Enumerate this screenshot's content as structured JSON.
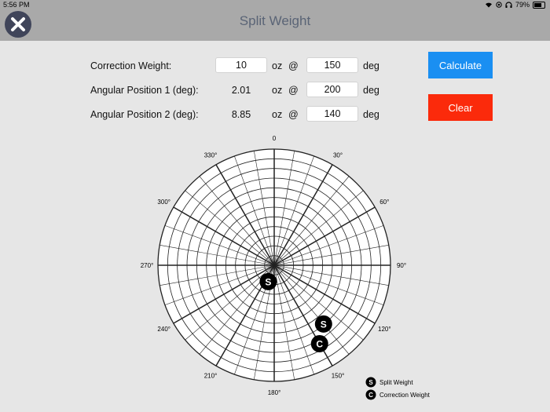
{
  "status": {
    "time": "5:56 PM",
    "battery": "79%",
    "battery_level": 0.79
  },
  "nav": {
    "title": "Split Weight"
  },
  "form": {
    "rows": [
      {
        "label": "Correction Weight:",
        "amount": "10",
        "amount_editable": true,
        "unit": "oz",
        "at": "@",
        "angle": "150",
        "angle_unit": "deg"
      },
      {
        "label": "Angular Position 1 (deg):",
        "amount": "2.01",
        "amount_editable": false,
        "unit": "oz",
        "at": "@",
        "angle": "200",
        "angle_unit": "deg"
      },
      {
        "label": "Angular Position 2 (deg):",
        "amount": "8.85",
        "amount_editable": false,
        "unit": "oz",
        "at": "@",
        "angle": "140",
        "angle_unit": "deg"
      }
    ]
  },
  "buttons": {
    "calculate": "Calculate",
    "clear": "Clear"
  },
  "colors": {
    "accent": "#1a8ff2",
    "danger": "#fb2a0b",
    "header": "#a9a9a9",
    "background": "#e6e6e6"
  },
  "chart_data": {
    "type": "polar",
    "angle_labels": [
      "0",
      "30°",
      "60°",
      "90°",
      "120°",
      "150°",
      "180°",
      "210°",
      "240°",
      "270°",
      "300°",
      "330°"
    ],
    "rings": 12,
    "spokes_minor_deg": 10,
    "spokes_major_deg": 30,
    "markers": [
      {
        "label": "S",
        "angle": 200,
        "radius_fraction": 0.15
      },
      {
        "label": "S",
        "angle": 140,
        "radius_fraction": 0.66
      },
      {
        "label": "C",
        "angle": 150,
        "radius_fraction": 0.78
      }
    ],
    "legend": [
      {
        "symbol": "S",
        "text": "Split Weight"
      },
      {
        "symbol": "C",
        "text": "Correction Weight"
      }
    ]
  }
}
